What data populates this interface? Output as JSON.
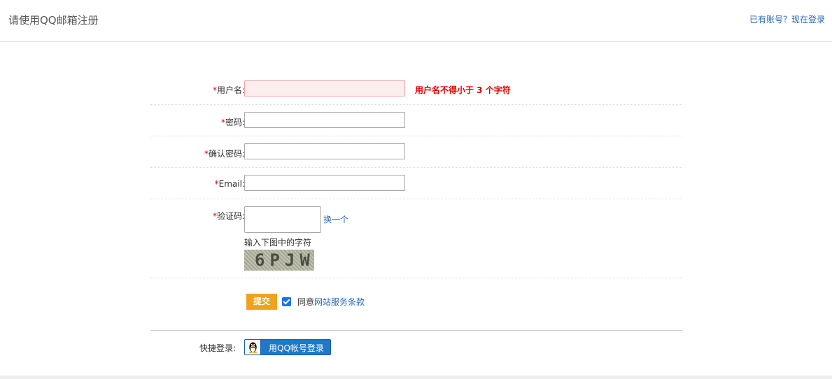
{
  "header": {
    "title": "请使用QQ邮箱注册",
    "login_link": "已有账号？现在登录"
  },
  "form": {
    "required_mark": "*",
    "username": {
      "label": "用户名:",
      "value": "",
      "error": "用户名不得小于 3 个字符"
    },
    "password": {
      "label": "密码:",
      "value": ""
    },
    "confirm_password": {
      "label": "确认密码:",
      "value": ""
    },
    "email": {
      "label": "Email:",
      "value": ""
    },
    "captcha": {
      "label": "验证码:",
      "value": "",
      "refresh_label": "换一个",
      "hint": "输入下图中的字符",
      "code": "6PJW"
    },
    "submit_label": "提交",
    "agree": {
      "checked": true,
      "prefix": "同意",
      "terms_link": "网站服务条款"
    }
  },
  "quick_login": {
    "label": "快捷登录:",
    "qq_button_label": "用QQ帐号登录"
  },
  "colors": {
    "error": "#dd0000",
    "link": "#2a6ab8",
    "submit": "#f0a31a",
    "qq_button": "#1f78c8"
  },
  "icons": {
    "qq": "qq-penguin-icon",
    "check": "checkmark-icon"
  }
}
